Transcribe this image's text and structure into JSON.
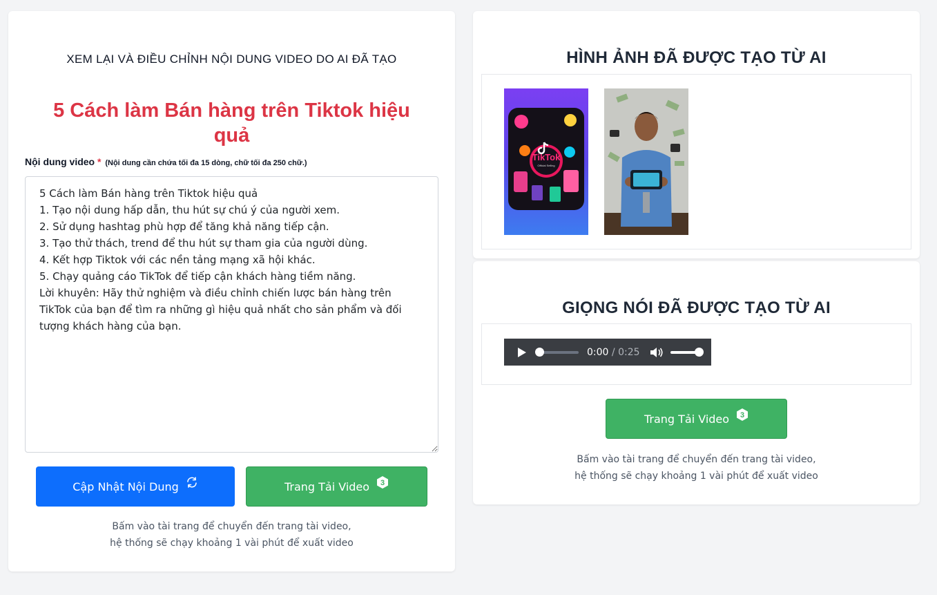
{
  "left": {
    "heading": "XEM LẠI VÀ ĐIỀU CHỈNH NỘI DUNG VIDEO DO AI ĐÃ TẠO",
    "title": "5 Cách làm Bán hàng trên Tiktok hiệu quả",
    "field_label": "Nội dung video",
    "required_mark": "*",
    "field_note": "(Nội dung cần chứa tối đa 15 dòng, chữ tối đa 250 chữ.)",
    "content": "5 Cách làm Bán hàng trên Tiktok hiệu quả\n1. Tạo nội dung hấp dẫn, thu hút sự chú ý của người xem.\n2. Sử dụng hashtag phù hợp để tăng khả năng tiếp cận.\n3. Tạo thử thách, trend để thu hút sự tham gia của người dùng.\n4. Kết hợp Tiktok với các nền tảng mạng xã hội khác.\n5. Chạy quảng cáo TikTok để tiếp cận khách hàng tiềm năng.\nLời khuyên: Hãy thử nghiệm và điều chỉnh chiến lược bán hàng trên TikTok của bạn để tìm ra những gì hiệu quả nhất cho sản phẩm và đối tượng khách hàng của bạn.",
    "update_button": "Cập Nhật Nội Dung",
    "download_button": "Trang Tải Video",
    "download_badge": "3",
    "hint_line1": "Bấm vào tài trang để chuyển đến trang tài video,",
    "hint_line2": "hệ thống sẽ chạy khoảng 1 vài phút để xuất video"
  },
  "images": {
    "title": "HÌNH ẢNH ĐÃ ĐƯỢC TẠO TỪ AI",
    "items": [
      {
        "label": "TikTok",
        "sublabel": "Official Selling",
        "icon": "tiktok-collage-image"
      },
      {
        "icon": "man-holding-phone-money-image"
      }
    ]
  },
  "voice": {
    "title": "GIỌNG NÓI ĐÃ ĐƯỢC TẠO TỪ AI",
    "current_time": "0:00",
    "separator": "/",
    "duration": "0:25",
    "download_button": "Trang Tải Video",
    "download_badge": "3",
    "hint_line1": "Bấm vào tài trang để chuyển đến trang tài video,",
    "hint_line2": "hệ thống sẽ chạy khoảng 1 vài phút để xuất video"
  },
  "colors": {
    "title_red": "#dc3545",
    "primary_blue": "#0d6efd",
    "success_green": "#3fb264",
    "audio_bg": "#3a3d42"
  }
}
